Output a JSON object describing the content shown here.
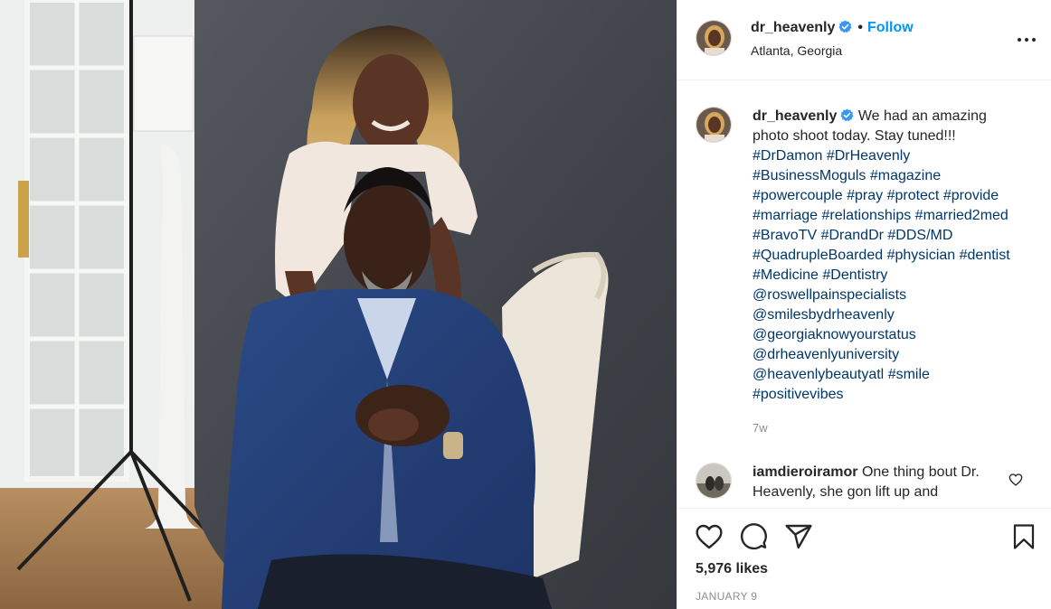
{
  "post": {
    "author": {
      "username": "dr_heavenly",
      "verified": true,
      "follow_label": "Follow",
      "location": "Atlanta, Georgia"
    },
    "caption": {
      "username": "dr_heavenly",
      "text": "We had an amazing photo shoot today. Stay tuned!!!",
      "tags": [
        "#DrDamon",
        "#DrHeavenly",
        "#BusinessMoguls",
        "#magazine",
        "#powercouple",
        "#pray",
        "#protect",
        "#provide",
        "#marriage",
        "#relationships",
        "#married2med",
        "#BravoTV",
        "#DrandDr",
        "#DDS/MD",
        "#QuadrupleBoarded",
        "#physician",
        "#dentist",
        "#Medicine",
        "#Dentistry",
        "@roswellpainspecialists",
        "@smilesbydrheavenly",
        "@georgiaknowyourstatus",
        "@drheavenlyuniversity",
        "@heavenlybeautyatl",
        "#smile",
        "#positivevibes"
      ],
      "time_ago": "7w"
    },
    "comments": [
      {
        "username": "iamdieroiramor",
        "text": "One thing bout Dr. Heavenly, she gon lift up and"
      }
    ],
    "likes_label": "5,976 likes",
    "date": "JANUARY 9",
    "icons": {
      "more": "more-options-icon",
      "like": "heart-icon",
      "comment": "comment-bubble-icon",
      "share": "paper-plane-icon",
      "save": "bookmark-icon",
      "verified": "verified-badge-icon"
    },
    "colors": {
      "link": "#00376b",
      "follow": "#0095f6",
      "verified": "#3897f0",
      "muted": "#8e8e8e"
    }
  }
}
